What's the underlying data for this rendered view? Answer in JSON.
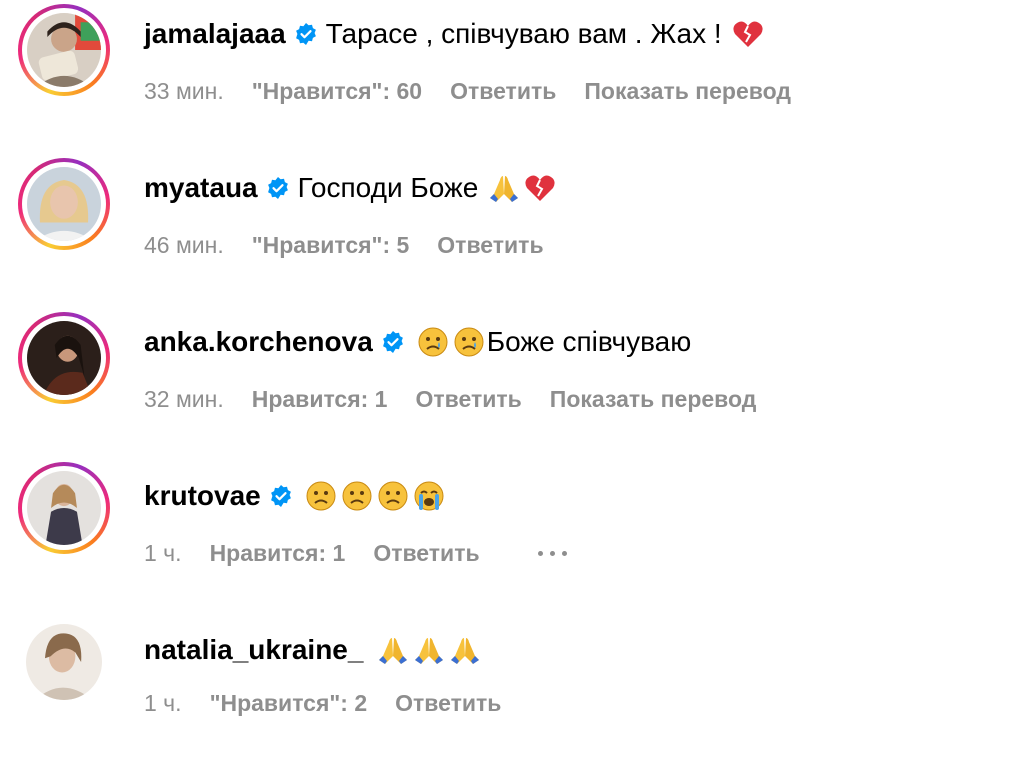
{
  "comments": [
    {
      "username": "jamalajaaa",
      "verified": true,
      "text": "Тарасе , співчуваю вам . Жах !",
      "emojis": [
        "broken-heart"
      ],
      "time": "33 мин.",
      "likes": "\"Нравится\": 60",
      "reply": "Ответить",
      "translate": "Показать перевод",
      "story_ring": true
    },
    {
      "username": "myataua",
      "verified": true,
      "text": "Господи Боже",
      "emojis": [
        "folded-hands",
        "broken-heart"
      ],
      "time": "46 мин.",
      "likes": "\"Нравится\": 5",
      "reply": "Ответить",
      "story_ring": true
    },
    {
      "username": "anka.korchenova",
      "verified": true,
      "emojis_before_text": [
        "crying-face",
        "crying-face"
      ],
      "text": "Боже співчуваю",
      "time": "32 мин.",
      "likes": "Нравится: 1",
      "reply": "Ответить",
      "translate": "Показать перевод",
      "story_ring": true
    },
    {
      "username": "krutovae",
      "verified": true,
      "text": "",
      "emojis": [
        "sad-face",
        "sad-face",
        "sad-face",
        "loudly-crying-face"
      ],
      "time": "1 ч.",
      "likes": "Нравится: 1",
      "reply": "Ответить",
      "more": "more-options-icon",
      "story_ring": true
    },
    {
      "username": "natalia_ukraine_",
      "verified": false,
      "text": "",
      "emojis": [
        "folded-hands",
        "folded-hands",
        "folded-hands"
      ],
      "time": "1 ч.",
      "likes": "\"Нравится\": 2",
      "reply": "Ответить",
      "story_ring": false
    }
  ],
  "colors": {
    "text": "#000000",
    "meta": "#8e8e8e",
    "verified": "#0095f6"
  }
}
